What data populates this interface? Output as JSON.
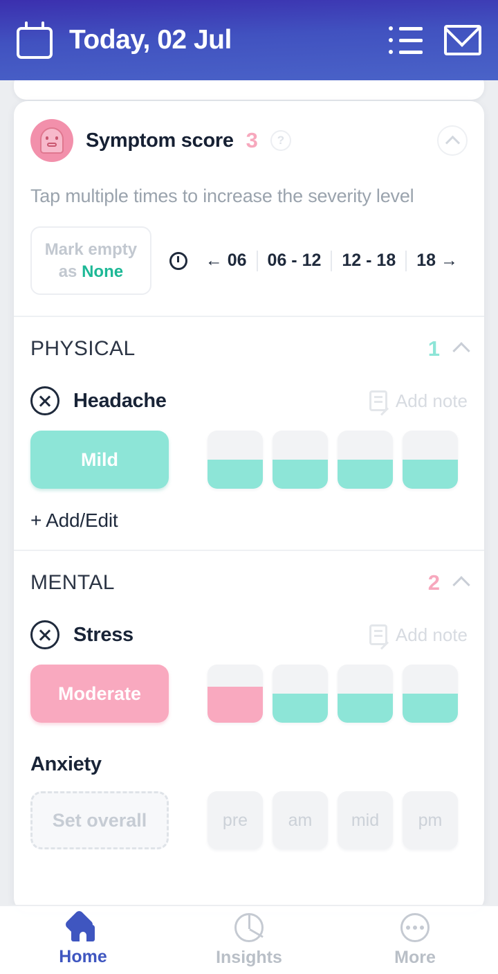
{
  "header": {
    "title": "Today, 02 Jul",
    "calendar_icon": "calendar-icon",
    "list_icon": "list-icon",
    "mail_icon": "mail-icon",
    "gradient_from": "#3b2fae",
    "gradient_to": "#4a63c8"
  },
  "card": {
    "title": "Symptom score",
    "score": "3",
    "help_icon": "question-mark-icon",
    "collapse_icon": "chevron-up-icon",
    "avatar_icon": "ghost-avatar-icon",
    "tip": "Tap multiple times to increase the severity level",
    "mark_empty": {
      "line1": "Mark empty",
      "line2_prefix": "as ",
      "line2_accent": "None"
    },
    "clock_icon": "clock-icon",
    "time_slots": [
      "← 06",
      "06 - 12",
      "12 - 18",
      "18 →"
    ]
  },
  "sections": [
    {
      "title": "PHYSICAL",
      "count": "1",
      "count_color": "#8de5d7",
      "chevron_icon": "chevron-up-icon",
      "symptoms": [
        {
          "name": "Headache",
          "remove_icon": "x-circle-icon",
          "note_icon": "note-pencil-icon",
          "note_label": "Add note",
          "level_label": "Mild",
          "level_style": "teal",
          "cells": [
            {
              "fill_color": "#8de5d7",
              "fill_pct": 50,
              "label": ""
            },
            {
              "fill_color": "#8de5d7",
              "fill_pct": 50,
              "label": ""
            },
            {
              "fill_color": "#8de5d7",
              "fill_pct": 50,
              "label": ""
            },
            {
              "fill_color": "#8de5d7",
              "fill_pct": 50,
              "label": ""
            }
          ]
        }
      ],
      "add_edit_label": "+ Add/Edit"
    },
    {
      "title": "MENTAL",
      "count": "2",
      "count_color": "#f7a8bd",
      "chevron_icon": "chevron-up-icon",
      "symptoms": [
        {
          "name": "Stress",
          "remove_icon": "x-circle-icon",
          "note_icon": "note-pencil-icon",
          "note_label": "Add note",
          "level_label": "Moderate",
          "level_style": "pink",
          "cells": [
            {
              "fill_color": "#f9a9bf",
              "fill_pct": 62,
              "label": ""
            },
            {
              "fill_color": "#8de5d7",
              "fill_pct": 50,
              "label": ""
            },
            {
              "fill_color": "#8de5d7",
              "fill_pct": 50,
              "label": ""
            },
            {
              "fill_color": "#8de5d7",
              "fill_pct": 50,
              "label": ""
            }
          ]
        },
        {
          "name": "Anxiety",
          "level_label": "Set overall",
          "level_style": "dashed",
          "cells": [
            {
              "fill_color": "",
              "fill_pct": 0,
              "label": "pre"
            },
            {
              "fill_color": "",
              "fill_pct": 0,
              "label": "am"
            },
            {
              "fill_color": "",
              "fill_pct": 0,
              "label": "mid"
            },
            {
              "fill_color": "",
              "fill_pct": 0,
              "label": "pm"
            }
          ]
        }
      ]
    }
  ],
  "bottom_nav": [
    {
      "label": "Home",
      "icon": "home-icon",
      "active": true
    },
    {
      "label": "Insights",
      "icon": "pie-chart-icon",
      "active": false
    },
    {
      "label": "More",
      "icon": "ellipsis-circle-icon",
      "active": false
    }
  ]
}
